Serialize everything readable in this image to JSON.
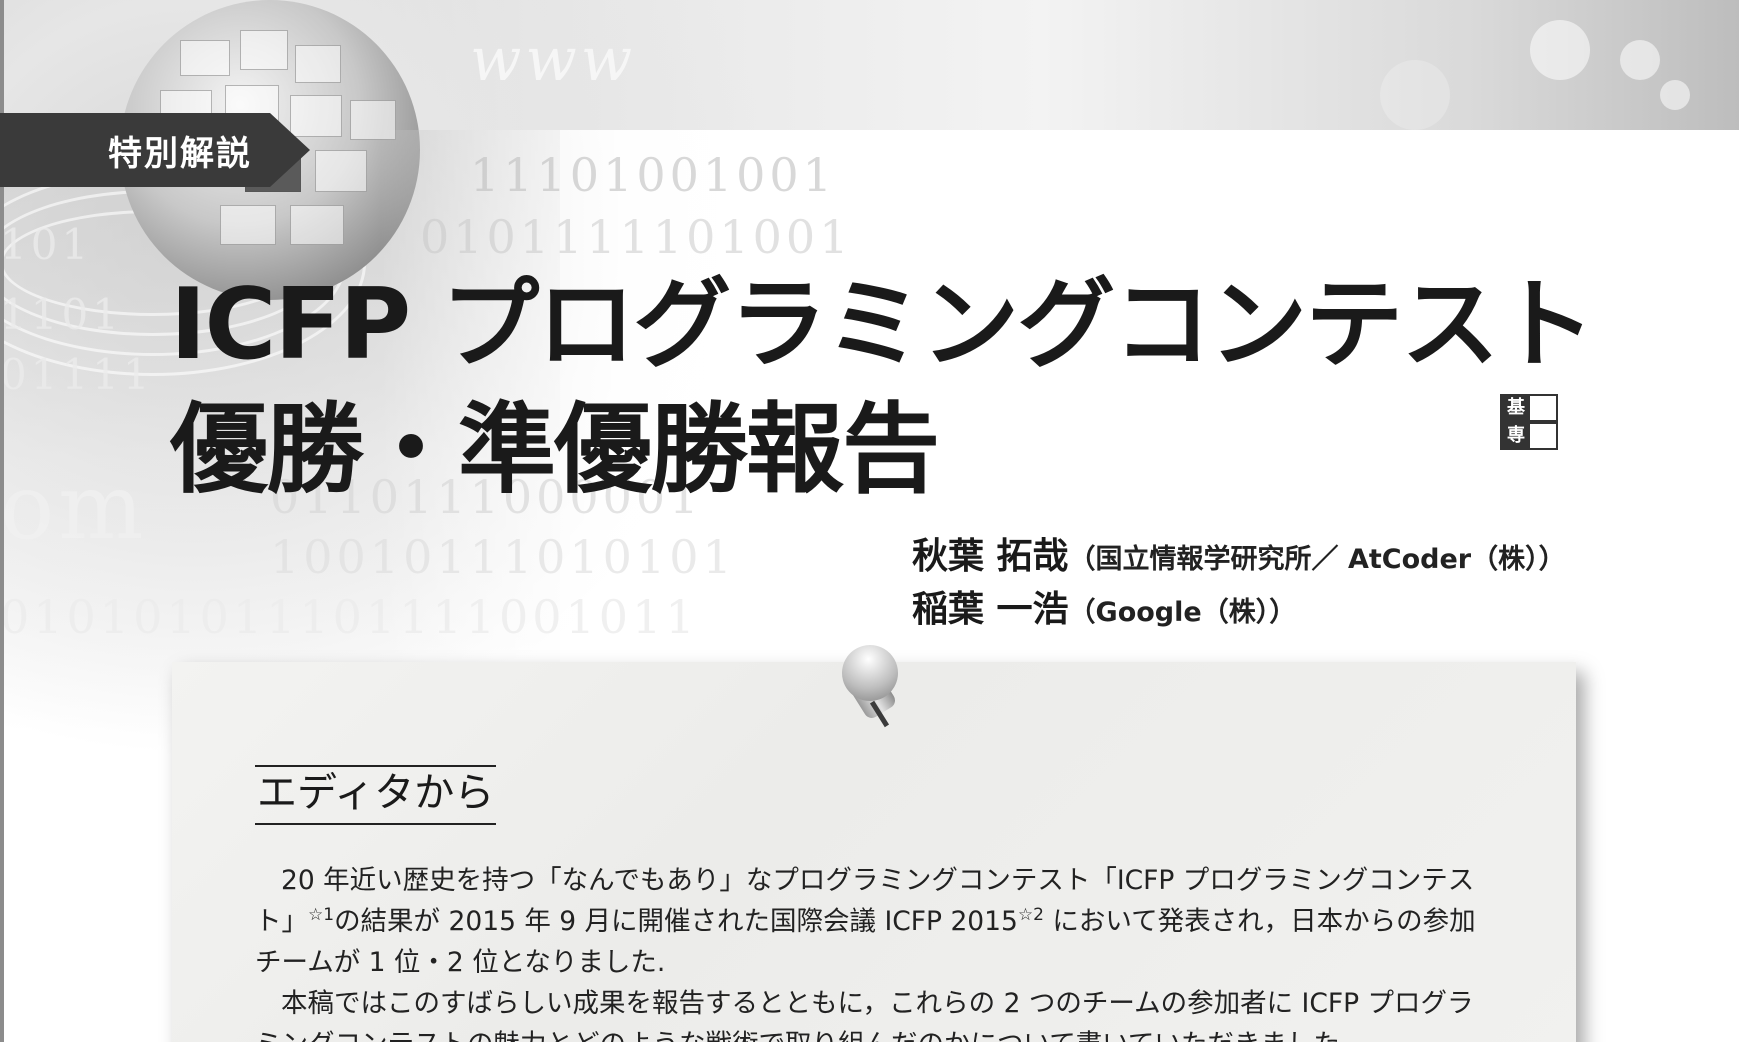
{
  "section_tag": "特別解説",
  "title": {
    "line1": "ICFP プログラミングコンテスト",
    "line2": "優勝・準優勝報告"
  },
  "level_marks": [
    "基",
    "専"
  ],
  "authors": [
    {
      "name": "秋葉 拓哉",
      "affiliation": "（国立情報学研究所／ AtCoder（株））"
    },
    {
      "name": "稲葉 一浩",
      "affiliation": "（Google（株））"
    }
  ],
  "editor_note": {
    "heading": "エディタから",
    "p1_a": "20 年近い歴史を持つ「なんでもあり」なプログラミングコンテスト「ICFP プログラミングコンテスト」",
    "p1_fn1": "☆1",
    "p1_b": "の結果が 2015 年 9 月に開催された国際会議 ICFP 2015",
    "p1_fn2": "☆2",
    "p1_c": " において発表され，日本からの参加チームが 1 位・2 位となりました.",
    "p2": "本稿ではこのすばらしい成果を報告するとともに，これらの 2 つのチームの参加者に ICFP プログラミングコンテストの魅力とどのような戦術で取り組んだのかについて書いていただきました."
  },
  "background_text": {
    "binary_1": "11101001001",
    "binary_2": "0101111101001",
    "binary_3": "101",
    "binary_4": "1101",
    "binary_5": "01111",
    "binary_6": "0110111000001",
    "binary_7": "10010111010101",
    "binary_8": "010101011101111001011",
    "big_1": "om",
    "big_2": "www"
  }
}
